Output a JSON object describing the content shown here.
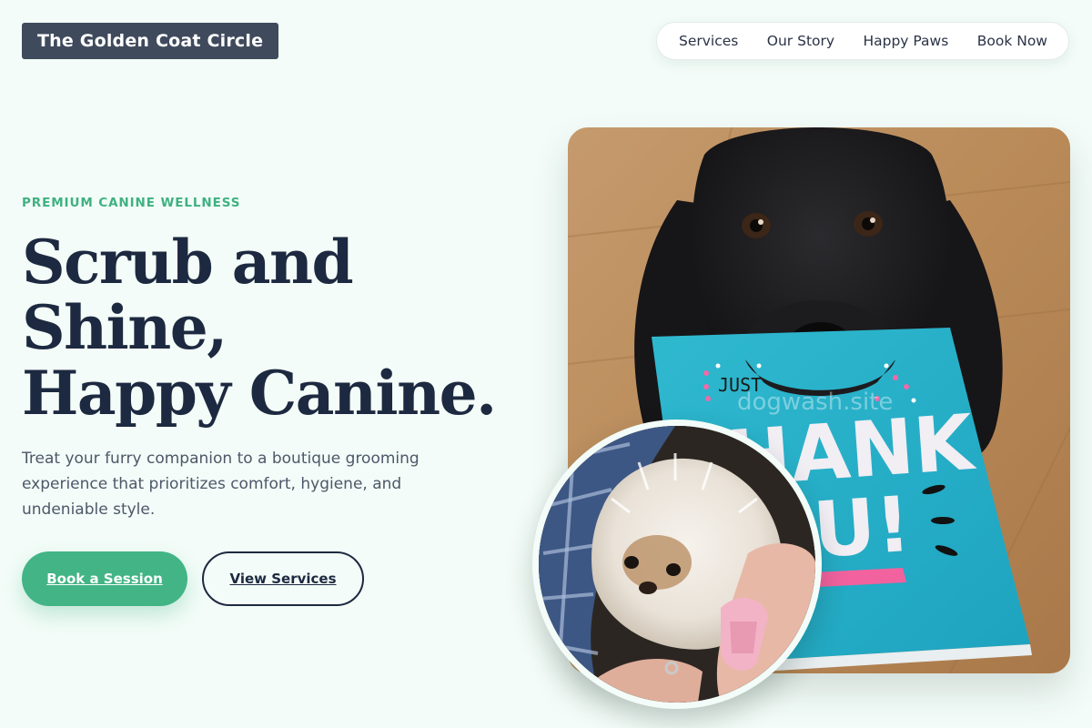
{
  "header": {
    "brand": "The Golden Coat Circle",
    "nav": [
      "Services",
      "Our Story",
      "Happy Paws",
      "Book Now"
    ]
  },
  "hero": {
    "eyebrow": "PREMIUM CANINE WELLNESS",
    "headline": [
      "Scrub and",
      "Shine,",
      "Happy Canine."
    ],
    "lede": "Treat your furry companion to a boutique grooming experience that prioritizes comfort, hygiene, and undeniable style.",
    "primary_cta": "Book a Session",
    "secondary_cta": "View Services"
  },
  "images": {
    "main_watermark": "dogwash.site",
    "card_text_top": "JUST",
    "card_text_big": "HANK",
    "card_text_big2": "U!"
  },
  "colors": {
    "background": "#f3fcf8",
    "accent_green": "#42b485",
    "navy": "#1d2940",
    "brand_box": "#3f4a5c"
  }
}
